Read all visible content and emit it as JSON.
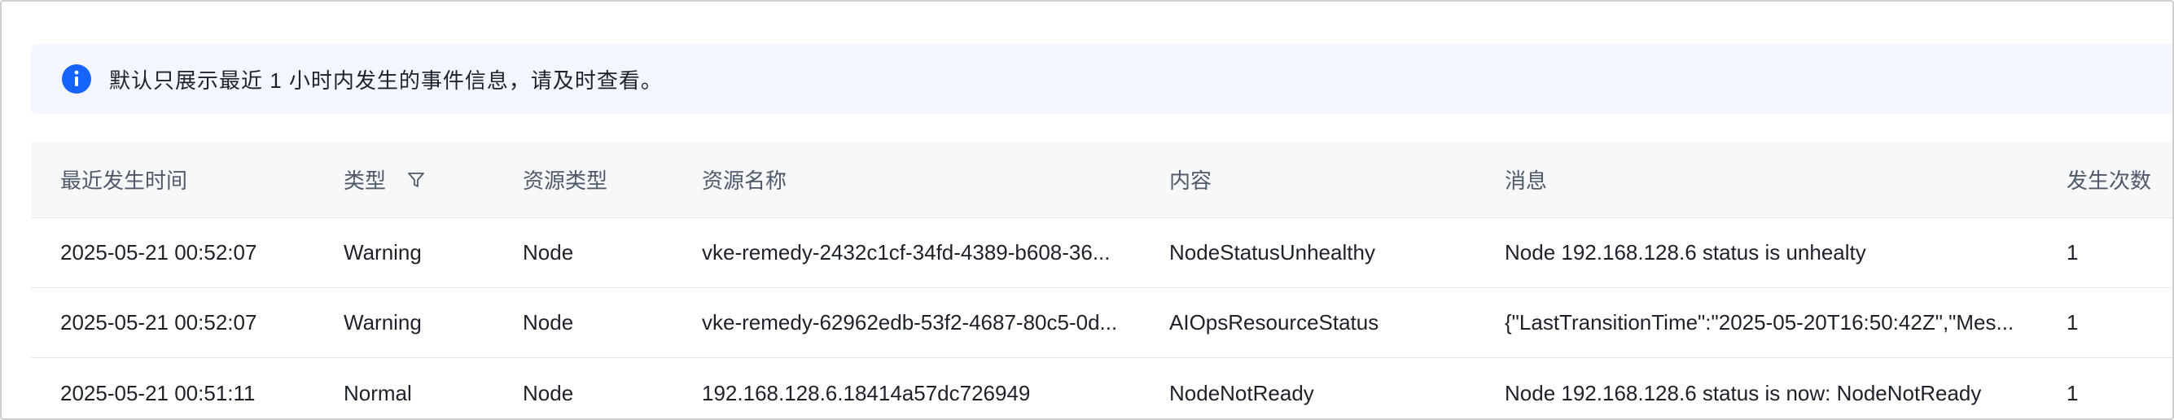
{
  "notice": {
    "icon": "info-icon",
    "color": "#1664ff",
    "text": "默认只展示最近 1 小时内发生的事件信息，请及时查看。"
  },
  "table": {
    "columns": [
      "最近发生时间",
      "类型",
      "资源类型",
      "资源名称",
      "内容",
      "消息",
      "发生次数"
    ],
    "filter_icon": "filter-icon",
    "rows": [
      {
        "time": "2025-05-21 00:52:07",
        "type": "Warning",
        "resource_type": "Node",
        "resource_name": "vke-remedy-2432c1cf-34fd-4389-b608-36...",
        "content": "NodeStatusUnhealthy",
        "message": "Node 192.168.128.6 status is unhealty",
        "count": "1"
      },
      {
        "time": "2025-05-21 00:52:07",
        "type": "Warning",
        "resource_type": "Node",
        "resource_name": "vke-remedy-62962edb-53f2-4687-80c5-0d...",
        "content": "AIOpsResourceStatus",
        "message": "{\"LastTransitionTime\":\"2025-05-20T16:50:42Z\",\"Mes...",
        "count": "1"
      },
      {
        "time": "2025-05-21 00:51:11",
        "type": "Normal",
        "resource_type": "Node",
        "resource_name": "192.168.128.6.18414a57dc726949",
        "content": "NodeNotReady",
        "message": "Node 192.168.128.6 status is now: NodeNotReady",
        "count": "1"
      }
    ]
  }
}
